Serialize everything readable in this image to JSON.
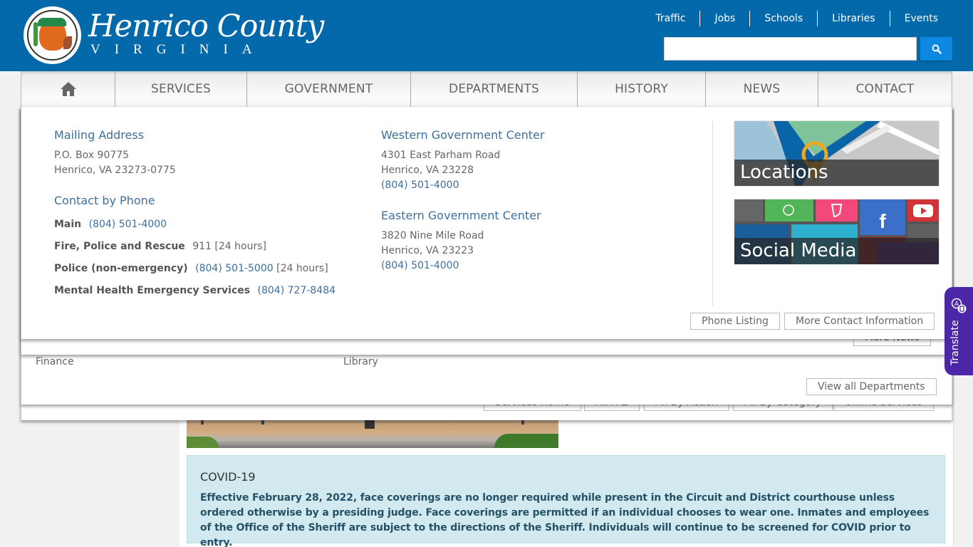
{
  "header": {
    "site_title": "Henrico County",
    "site_subtitle": "VIRGINIA",
    "seal_text": "COUNTY OF HENRICO, VIRGINIA",
    "top_links": [
      "Traffic",
      "Jobs",
      "Schools",
      "Libraries",
      "Events"
    ],
    "search": {
      "value": "",
      "placeholder": "",
      "icon": "search-icon"
    }
  },
  "nav": {
    "home_icon": "home-icon",
    "items": [
      "SERVICES",
      "GOVERNMENT",
      "DEPARTMENTS",
      "HISTORY",
      "NEWS",
      "CONTACT"
    ]
  },
  "services_menu": {
    "buttons": [
      "Services Home",
      "All A-Z",
      "All By Action",
      "All By Category",
      "Online Services"
    ]
  },
  "departments_menu": {
    "visible_links": [
      "Finance",
      "Library"
    ],
    "view_all_label": "View all Departments"
  },
  "news_menu": {
    "more_label": "More News"
  },
  "contact_menu": {
    "mailing": {
      "heading": "Mailing Address",
      "line1": "P.O. Box 90775",
      "line2": "Henrico, VA 23273-0775"
    },
    "phone": {
      "heading": "Contact by Phone",
      "rows": [
        {
          "label": "Main",
          "value": "(804) 501-4000",
          "note": ""
        },
        {
          "label": "Fire, Police and Rescue",
          "value": "911",
          "note": "[24 hours]"
        },
        {
          "label": "Police (non-emergency)",
          "value": "(804) 501-5000",
          "note": "[24 hours]"
        },
        {
          "label": "Mental Health Emergency Services",
          "value": "(804) 727-8484",
          "note": ""
        }
      ]
    },
    "western": {
      "heading": "Western Government Center",
      "line1": "4301 East Parham Road",
      "line2": "Henrico, VA 23228",
      "phone": "(804) 501-4000"
    },
    "eastern": {
      "heading": "Eastern Government Center",
      "line1": "3820 Nine Mile Road",
      "line2": "Henrico, VA 23223",
      "phone": "(804) 501-4000"
    },
    "tiles": [
      {
        "label": "Locations",
        "icon": "map-pin-icon"
      },
      {
        "label": "Social Media",
        "icon": "social-tiles-icon"
      }
    ],
    "buttons": {
      "phone_listing": "Phone Listing",
      "more_contact": "More Contact Information"
    }
  },
  "alert": {
    "title": "COVID-19",
    "body": "Effective February 28, 2022, face coverings are no longer required while present in the Circuit and District courthouse unless ordered otherwise by a presiding judge. Face coverings are permitted if an individual chooses to wear one. Inmates and employees of the Office of the Sheriff are subject to the directions of the Sheriff. Individuals will continue to be screened for COVID prior to entry."
  },
  "translate": {
    "label": "Translate",
    "icon": "translate-icon"
  },
  "colors": {
    "header_blue": "#0469aa",
    "search_button": "#0c88e0",
    "link_blue": "#3d6f9d",
    "alert_bg": "#d2eaef",
    "alert_text": "#245166",
    "translate_purple": "#4b27a8"
  }
}
